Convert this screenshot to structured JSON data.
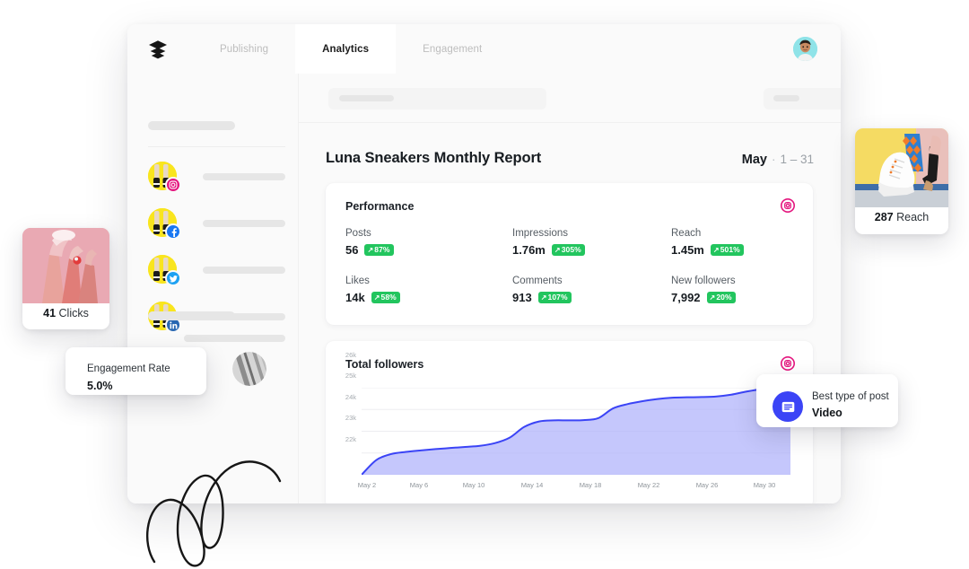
{
  "app": {
    "logo_name": "buffer-logo",
    "tabs": [
      {
        "label": "Publishing",
        "active": false
      },
      {
        "label": "Analytics",
        "active": true
      },
      {
        "label": "Engagement",
        "active": false
      }
    ],
    "user_avatar": "user-avatar"
  },
  "sidebar": {
    "accounts": [
      {
        "network": "instagram",
        "color": "#e4157e"
      },
      {
        "network": "facebook",
        "color": "#1877f2"
      },
      {
        "network": "twitter",
        "color": "#1da1f2"
      },
      {
        "network": "linkedin",
        "color": "#2867b2"
      }
    ]
  },
  "report": {
    "title": "Luna Sneakers Monthly Report",
    "month": "May",
    "separator": "·",
    "range": "1 – 31"
  },
  "performance": {
    "title": "Performance",
    "network_icon": "instagram-icon",
    "stats": [
      {
        "label": "Posts",
        "value": "56",
        "change": "87%",
        "direction": "up"
      },
      {
        "label": "Impressions",
        "value": "1.76m",
        "change": "305%",
        "direction": "up"
      },
      {
        "label": "Reach",
        "value": "1.45m",
        "change": "501%",
        "direction": "up"
      },
      {
        "label": "Likes",
        "value": "14k",
        "change": "58%",
        "direction": "up"
      },
      {
        "label": "Comments",
        "value": "913",
        "change": "107%",
        "direction": "up"
      },
      {
        "label": "New followers",
        "value": "7,992",
        "change": "20%",
        "direction": "up"
      }
    ]
  },
  "followers_card": {
    "title": "Total followers",
    "network_icon": "instagram-icon"
  },
  "chart_data": {
    "type": "area",
    "title": "Total followers",
    "xlabel": "",
    "ylabel": "",
    "ylim": [
      22000,
      26000
    ],
    "ytick_labels": [
      "22k",
      "23k",
      "24k",
      "25k",
      "26k"
    ],
    "yticks": [
      22000,
      23000,
      24000,
      25000,
      26000
    ],
    "xtick_labels": [
      "May 2",
      "May 6",
      "May 10",
      "May 14",
      "May 18",
      "May 22",
      "May 26",
      "May 30"
    ],
    "grid": true,
    "legend": null,
    "line_color": "#3b44f6",
    "fill_color": "#aeb2fb",
    "x": [
      1,
      2,
      3,
      4,
      5,
      6,
      7,
      8,
      9,
      10,
      11,
      12,
      13,
      14,
      15,
      16,
      17,
      18,
      19,
      20,
      21,
      22,
      23,
      24,
      25,
      26,
      27,
      28,
      29,
      30
    ],
    "values": [
      22000,
      22680,
      22950,
      23050,
      23120,
      23180,
      23230,
      23280,
      23330,
      23450,
      23700,
      24200,
      24450,
      24500,
      24500,
      24510,
      24600,
      25050,
      25250,
      25380,
      25480,
      25540,
      25560,
      25570,
      25600,
      25680,
      25820,
      25930,
      25970,
      25980
    ]
  },
  "floating": {
    "clicks_card": {
      "value": "41",
      "label": "Clicks",
      "image": "sneaker-legs-pink-photo"
    },
    "reach_card": {
      "value": "287",
      "label": "Reach",
      "image": "sneaker-heel-yellow-photo"
    },
    "best_post": {
      "title": "Best type of post",
      "value": "Video",
      "icon": "post-list-icon"
    },
    "engagement": {
      "title": "Engagement Rate",
      "value": "5.0%"
    }
  }
}
